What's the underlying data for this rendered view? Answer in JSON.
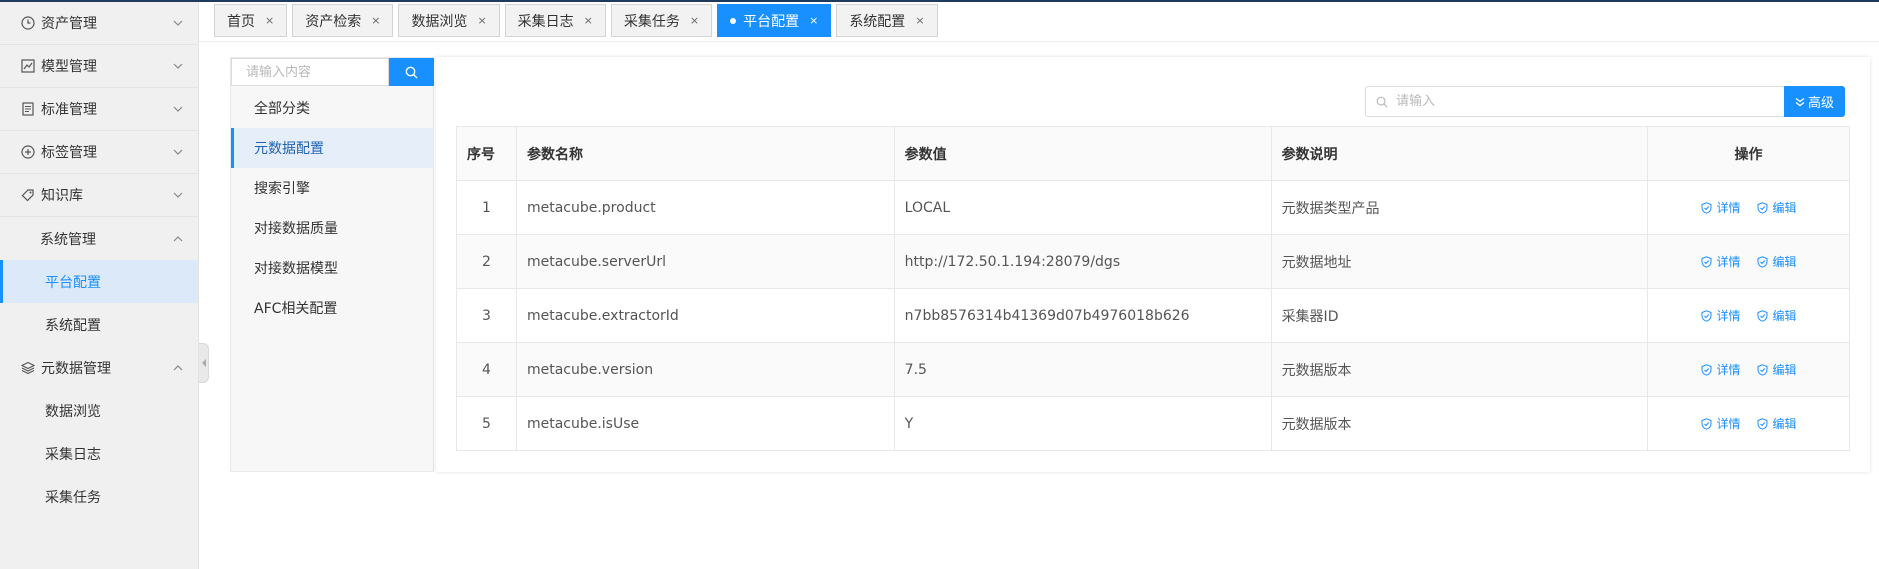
{
  "tabs": [
    {
      "label": "首页",
      "active": false
    },
    {
      "label": "资产检索",
      "active": false
    },
    {
      "label": "数据浏览",
      "active": false
    },
    {
      "label": "采集日志",
      "active": false
    },
    {
      "label": "采集任务",
      "active": false
    },
    {
      "label": "平台配置",
      "active": true
    },
    {
      "label": "系统配置",
      "active": false
    }
  ],
  "tab_close": "×",
  "sidebar": {
    "asset_mgmt": "资产管理",
    "model_mgmt": "模型管理",
    "standard_mgmt": "标准管理",
    "tag_mgmt": "标签管理",
    "knowledge_base": "知识库",
    "system_mgmt": "系统管理",
    "platform_config": "平台配置",
    "system_config": "系统配置",
    "metadata_mgmt": "元数据管理",
    "data_browse": "数据浏览",
    "collect_log": "采集日志",
    "collect_task": "采集任务"
  },
  "left_panel": {
    "search_placeholder": "请输入内容",
    "categories": [
      "全部分类",
      "元数据配置",
      "搜索引擎",
      "对接数据质量",
      "对接数据模型",
      "AFC相关配置"
    ],
    "active_index": 1
  },
  "table_search": {
    "placeholder": "请输入",
    "advanced_label": "高级"
  },
  "table": {
    "headers": [
      "序号",
      "参数名称",
      "参数值",
      "参数说明",
      "操作"
    ],
    "rows": [
      {
        "no": "1",
        "name": "metacube.product",
        "value": "LOCAL",
        "desc": "元数据类型产品"
      },
      {
        "no": "2",
        "name": "metacube.serverUrl",
        "value": "http://172.50.1.194:28079/dgs",
        "desc": "元数据地址"
      },
      {
        "no": "3",
        "name": "metacube.extractorId",
        "value": "n7bb8576314b41369d07b4976018b626",
        "desc": "采集器ID"
      },
      {
        "no": "4",
        "name": "metacube.version",
        "value": "7.5",
        "desc": "元数据版本"
      },
      {
        "no": "5",
        "name": "metacube.isUse",
        "value": "Y",
        "desc": "元数据版本"
      }
    ],
    "op_detail": "详情",
    "op_edit": "编辑"
  },
  "colors": {
    "accent": "#1890ff",
    "sidebar_bg": "#f0f0f0",
    "active_bg": "#dbe9f8"
  }
}
